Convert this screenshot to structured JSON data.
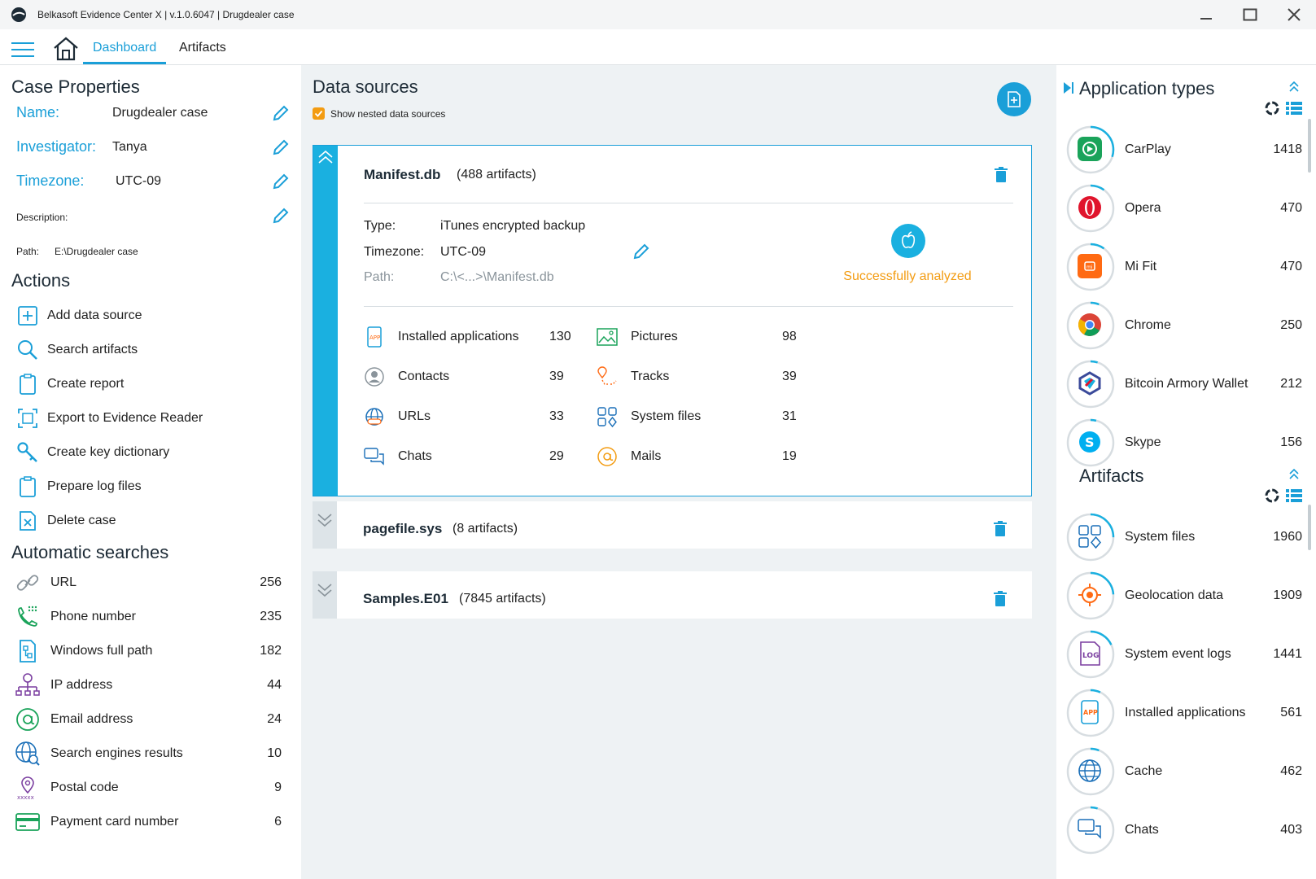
{
  "window": {
    "title": "Belkasoft Evidence Center X | v.1.0.6047 | Drugdealer case"
  },
  "tabs": {
    "dashboard": "Dashboard",
    "artifacts": "Artifacts"
  },
  "case": {
    "heading": "Case Properties",
    "name_label": "Name:",
    "name_value": "Drugdealer case",
    "investigator_label": "Investigator:",
    "investigator_value": "Tanya",
    "timezone_label": "Timezone:",
    "timezone_value": "UTC-09",
    "description_label": "Description:",
    "path_label": "Path:",
    "path_value": "E:\\Drugdealer case"
  },
  "actions": {
    "heading": "Actions",
    "items": [
      {
        "label": "Add data source",
        "icon": "add-icon"
      },
      {
        "label": "Search artifacts",
        "icon": "search-icon"
      },
      {
        "label": "Create report",
        "icon": "clipboard-icon"
      },
      {
        "label": "Export to Evidence Reader",
        "icon": "export-icon"
      },
      {
        "label": "Create key dictionary",
        "icon": "key-icon"
      },
      {
        "label": "Prepare log files",
        "icon": "clipboard-icon"
      },
      {
        "label": "Delete case",
        "icon": "delete-icon"
      }
    ]
  },
  "automatic_searches": {
    "heading": "Automatic searches",
    "items": [
      {
        "label": "URL",
        "count": "256",
        "icon": "link-icon"
      },
      {
        "label": "Phone number",
        "count": "235",
        "icon": "phone-icon"
      },
      {
        "label": "Windows full path",
        "count": "182",
        "icon": "path-icon"
      },
      {
        "label": "IP address",
        "count": "44",
        "icon": "network-icon"
      },
      {
        "label": "Email address",
        "count": "24",
        "icon": "at-icon"
      },
      {
        "label": "Search engines results",
        "count": "10",
        "icon": "globe-search-icon"
      },
      {
        "label": "Postal code",
        "count": "9",
        "icon": "pin-icon"
      },
      {
        "label": "Payment card number",
        "count": "6",
        "icon": "card-icon"
      }
    ]
  },
  "data_sources": {
    "heading": "Data sources",
    "show_nested_label": "Show nested data sources",
    "show_nested_checked": true,
    "sources": [
      {
        "name": "Manifest.db",
        "count_text": "(488 artifacts)",
        "expanded": true,
        "type_label": "Type:",
        "type_value": "iTunes encrypted backup",
        "timezone_label": "Timezone:",
        "timezone_value": "UTC-09",
        "path_label": "Path:",
        "path_value": "C:\\<...>\\Manifest.db",
        "status": "Successfully analyzed",
        "artifacts": [
          {
            "label": "Installed applications",
            "count": "130",
            "icon": "app-icon"
          },
          {
            "label": "Pictures",
            "count": "98",
            "icon": "picture-icon"
          },
          {
            "label": "Contacts",
            "count": "39",
            "icon": "contact-icon"
          },
          {
            "label": "Tracks",
            "count": "39",
            "icon": "track-icon"
          },
          {
            "label": "URLs",
            "count": "33",
            "icon": "globe-icon"
          },
          {
            "label": "System files",
            "count": "31",
            "icon": "system-files-icon"
          },
          {
            "label": "Chats",
            "count": "29",
            "icon": "chat-icon"
          },
          {
            "label": "Mails",
            "count": "19",
            "icon": "mail-icon"
          }
        ]
      },
      {
        "name": "pagefile.sys",
        "count_text": "(8 artifacts)",
        "expanded": false
      },
      {
        "name": "Samples.E01",
        "count_text": "(7845 artifacts)",
        "expanded": false
      }
    ]
  },
  "application_types": {
    "heading": "Application types",
    "items": [
      {
        "label": "CarPlay",
        "count": "1418",
        "color": "#2ecc40",
        "fraction": 0.3
      },
      {
        "label": "Opera",
        "count": "470",
        "color": "#e0142c",
        "fraction": 0.1
      },
      {
        "label": "Mi Fit",
        "count": "470",
        "color": "#ff6a13",
        "fraction": 0.1
      },
      {
        "label": "Chrome",
        "count": "250",
        "color": "#4285f4",
        "fraction": 0.06
      },
      {
        "label": "Bitcoin Armory Wallet",
        "count": "212",
        "color": "#3a4a9a",
        "fraction": 0.05
      },
      {
        "label": "Skype",
        "count": "156",
        "color": "#00aff0",
        "fraction": 0.04
      }
    ]
  },
  "artifacts_panel": {
    "heading": "Artifacts",
    "items": [
      {
        "label": "System files",
        "count": "1960",
        "icon": "system-files-icon",
        "fraction": 0.25
      },
      {
        "label": "Geolocation data",
        "count": "1909",
        "icon": "geolocation-icon",
        "fraction": 0.24
      },
      {
        "label": "System event logs",
        "count": "1441",
        "icon": "log-icon",
        "fraction": 0.18
      },
      {
        "label": "Installed applications",
        "count": "561",
        "icon": "app-icon",
        "fraction": 0.07
      },
      {
        "label": "Cache",
        "count": "462",
        "icon": "globe-icon",
        "fraction": 0.06
      },
      {
        "label": "Chats",
        "count": "403",
        "icon": "chat-icon",
        "fraction": 0.05
      }
    ]
  },
  "colors": {
    "accent": "#1a9fd8",
    "success": "#f39c12"
  }
}
